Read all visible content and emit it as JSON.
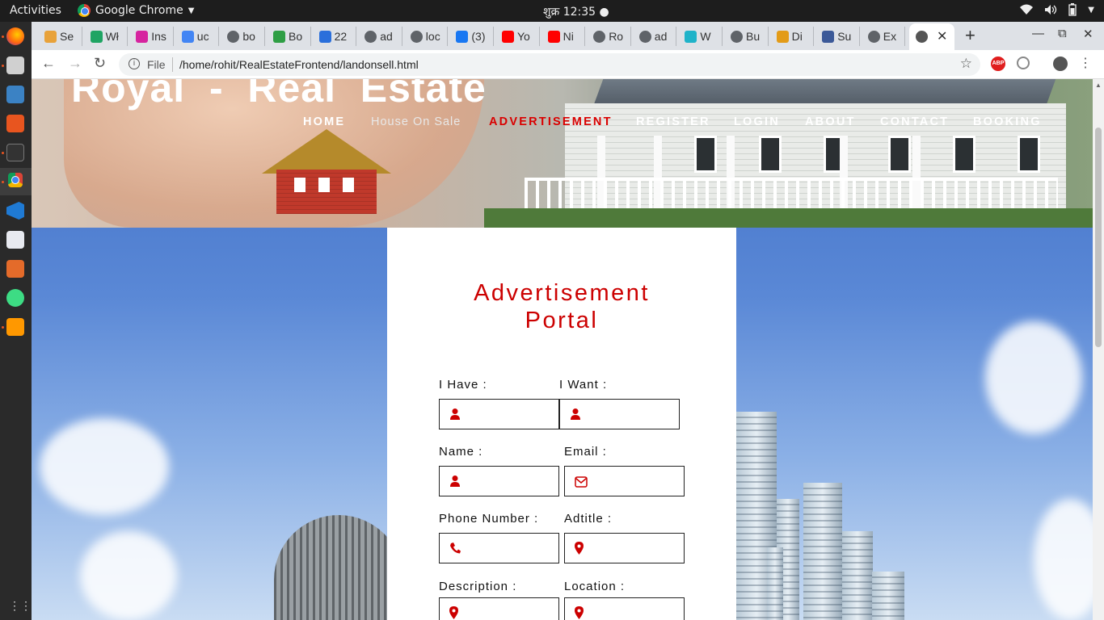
{
  "os": {
    "activities": "Activities",
    "app_name": "Google Chrome",
    "clock": "शुक्र 12:35 ●"
  },
  "browser": {
    "tabs": [
      {
        "label": "Se",
        "icon": "home-icon"
      },
      {
        "label": "Wł",
        "icon": "drive-icon"
      },
      {
        "label": "Ins",
        "icon": "instagram-icon"
      },
      {
        "label": "uc",
        "icon": "google-icon"
      },
      {
        "label": "bo",
        "icon": "globe-icon"
      },
      {
        "label": "Bo",
        "icon": "chart-icon"
      },
      {
        "label": "22",
        "icon": "u-icon"
      },
      {
        "label": "ad",
        "icon": "globe-icon"
      },
      {
        "label": "loc",
        "icon": "globe-icon"
      },
      {
        "label": "(3)",
        "icon": "facebook-icon"
      },
      {
        "label": "Yo",
        "icon": "youtube-icon"
      },
      {
        "label": "Ni",
        "icon": "youtube-icon"
      },
      {
        "label": "Ro",
        "icon": "globe-icon"
      },
      {
        "label": "ad",
        "icon": "globe-icon"
      },
      {
        "label": "W",
        "icon": "play-icon"
      },
      {
        "label": "Bu",
        "icon": "globe-icon"
      },
      {
        "label": "Di",
        "icon": "d-icon"
      },
      {
        "label": "Su",
        "icon": "lock-icon"
      },
      {
        "label": "Ex",
        "icon": "globe-icon"
      }
    ],
    "active_tab_close": "✕",
    "new_tab": "+",
    "address_scheme": "File",
    "address_url": "/home/rohit/RealEstateFrontend/landonsell.html",
    "abp_label": "ABP"
  },
  "site": {
    "title": "Royal  -  Real  Estate",
    "nav": [
      {
        "label": "HOME",
        "state": "normal"
      },
      {
        "label": "House On Sale",
        "state": "muted"
      },
      {
        "label": "ADVERTISEMENT",
        "state": "active"
      },
      {
        "label": "REGISTER",
        "state": "normal"
      },
      {
        "label": "LOGIN",
        "state": "normal"
      },
      {
        "label": "ABOUT",
        "state": "normal"
      },
      {
        "label": "CONTACT",
        "state": "normal"
      },
      {
        "label": "BOOKING",
        "state": "normal"
      }
    ]
  },
  "form": {
    "title": "Advertisement Portal",
    "fields": [
      {
        "label": "I Have :",
        "icon": "user-icon",
        "value": ""
      },
      {
        "label": "I Want :",
        "icon": "user-icon",
        "value": ""
      },
      {
        "label": "Name :",
        "icon": "user-icon",
        "value": ""
      },
      {
        "label": "Email :",
        "icon": "envelope-icon",
        "value": ""
      },
      {
        "label": "Phone Number :",
        "icon": "phone-icon",
        "value": ""
      },
      {
        "label": "Adtitle :",
        "icon": "map-marker-icon",
        "value": ""
      },
      {
        "label": "Description :",
        "icon": "map-marker-icon",
        "value": ""
      },
      {
        "label": "Location :",
        "icon": "map-marker-icon",
        "value": ""
      }
    ]
  },
  "colors": {
    "accent": "#cc0000",
    "nav_active": "#d90000"
  }
}
